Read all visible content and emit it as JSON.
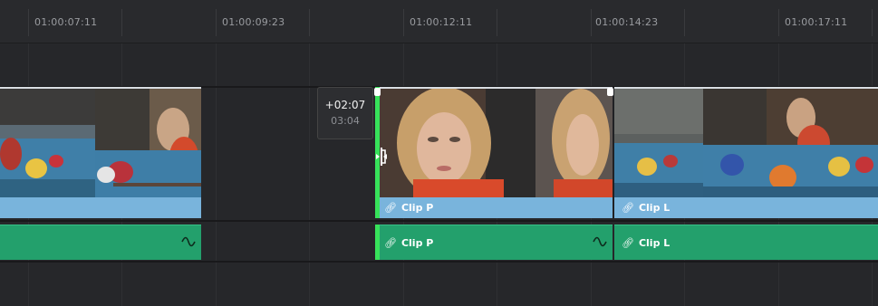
{
  "ruler": {
    "timecodes": [
      "01:00:07:11",
      "01:00:09:23",
      "01:00:12:11",
      "01:00:14:23",
      "01:00:17:11"
    ]
  },
  "tooltip": {
    "offset": "+02:07",
    "duration": "03:04"
  },
  "video_track": {
    "clips": [
      {
        "name": "",
        "linked": false
      },
      {
        "name": "Clip P",
        "linked": true
      },
      {
        "name": "Clip L",
        "linked": true
      }
    ]
  },
  "audio_track": {
    "clips": [
      {
        "name": "",
        "linked": false
      },
      {
        "name": "Clip P",
        "linked": true
      },
      {
        "name": "Clip L",
        "linked": true
      }
    ]
  },
  "colors": {
    "video_clip": "#79b4dc",
    "audio_clip": "#23a06c",
    "trim_edge": "#37e25a",
    "background": "#26272a"
  },
  "icons": {
    "link": "link-icon",
    "waveform": "audio-waveform-icon",
    "trim_cursor": "ripple-trim-cursor-icon"
  }
}
